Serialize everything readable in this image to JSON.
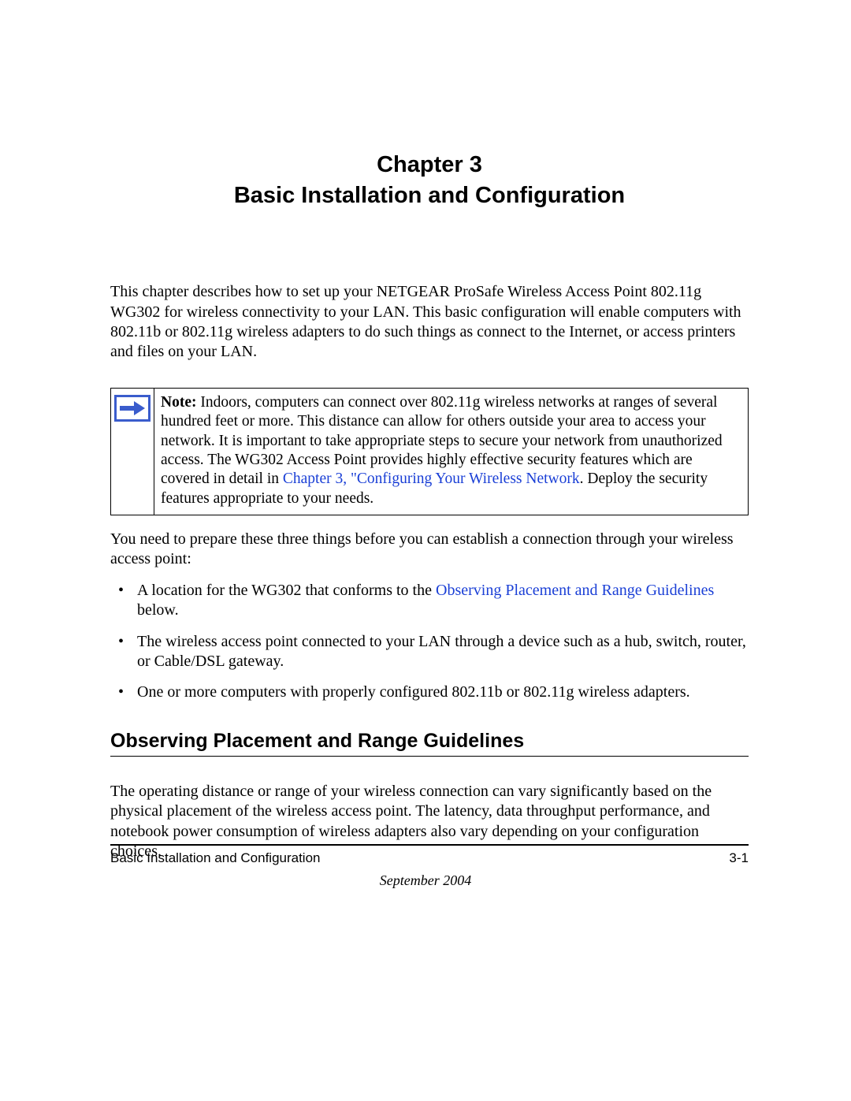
{
  "chapter": {
    "line1": "Chapter 3",
    "line2": "Basic Installation and Configuration"
  },
  "intro": "This chapter describes how to set up your NETGEAR ProSafe Wireless Access Point 802.11g WG302  for wireless connectivity to your LAN. This basic configuration will enable computers with 802.11b or 802.11g wireless adapters to do such things as connect to the Internet, or access printers and files on your LAN.",
  "note": {
    "label": "Note:",
    "pre": " Indoors, computers can connect over 802.11g wireless networks at ranges of several hundred feet or more. This distance can allow for others outside your area to access your network. It is important to take appropriate steps to secure your network from unauthorized access. The WG302 Access Point provides highly effective security features which are covered in detail in ",
    "link": "Chapter 3, \"Configuring Your Wireless Network",
    "post": ". Deploy the security features appropriate to your needs."
  },
  "prep_intro": "You need to prepare these three things before you can establish a connection through your wireless access point:",
  "bullets": {
    "b1_pre": "A location for the WG302 that conforms to the ",
    "b1_link": "Observing Placement and Range Guidelines",
    "b1_post": " below.",
    "b2": "The wireless access point connected to your LAN through a device such as a hub, switch, router, or Cable/DSL gateway.",
    "b3": "One or more computers with properly configured 802.11b or 802.11g wireless adapters."
  },
  "section_title": "Observing Placement and Range Guidelines",
  "section_body": "The operating distance or range of your wireless connection can vary significantly based on the physical placement of the wireless access point. The latency, data throughput performance, and notebook power consumption of wireless adapters also vary depending on your configuration choices.",
  "footer": {
    "left": "Basic Installation and Configuration",
    "right": "3-1",
    "date": "September 2004"
  }
}
